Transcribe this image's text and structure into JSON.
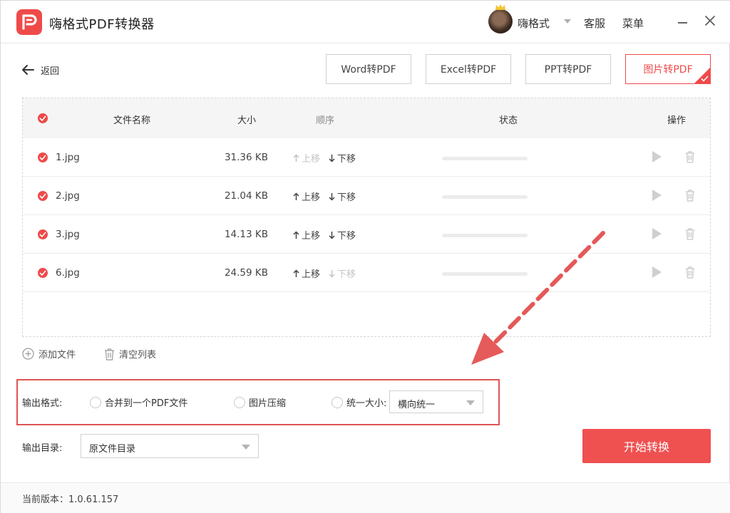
{
  "app": {
    "title": "嗨格式PDF转换器"
  },
  "header": {
    "user_name": "嗨格式",
    "service_label": "客服",
    "menu_label": "菜单"
  },
  "nav": {
    "back_label": "返回"
  },
  "tabs": [
    {
      "label": "Word转PDF",
      "active": false
    },
    {
      "label": "Excel转PDF",
      "active": false
    },
    {
      "label": "PPT转PDF",
      "active": false
    },
    {
      "label": "图片转PDF",
      "active": true
    }
  ],
  "table": {
    "headers": {
      "name": "文件名称",
      "size": "大小",
      "order": "顺序",
      "status": "状态",
      "ops": "操作"
    },
    "move_up_label": "上移",
    "move_down_label": "下移",
    "rows": [
      {
        "name": "1.jpg",
        "size": "31.36 KB",
        "up_enabled": false,
        "down_enabled": true
      },
      {
        "name": "2.jpg",
        "size": "21.04 KB",
        "up_enabled": true,
        "down_enabled": true
      },
      {
        "name": "3.jpg",
        "size": "14.13 KB",
        "up_enabled": true,
        "down_enabled": true
      },
      {
        "name": "6.jpg",
        "size": "24.59 KB",
        "up_enabled": true,
        "down_enabled": false
      }
    ]
  },
  "actions": {
    "add_file": "添加文件",
    "clear_list": "清空列表"
  },
  "output_format": {
    "label": "输出格式:",
    "options": [
      "合并到一个PDF文件",
      "图片压缩",
      "统一大小:"
    ],
    "size_select_value": "横向统一"
  },
  "output_dir": {
    "label": "输出目录:",
    "value": "原文件目录"
  },
  "start_button": "开始转换",
  "footer": {
    "version_text": "当前版本：1.0.61.157"
  },
  "colors": {
    "accent": "#ef4a4a",
    "highlight_box": "#e05454"
  },
  "icons": [
    "logo-icon",
    "crown-icon",
    "chevron-down-icon",
    "minimize-icon",
    "close-icon",
    "back-arrow-icon",
    "check-icon",
    "arrow-up-icon",
    "arrow-down-icon",
    "play-icon",
    "trash-icon",
    "add-circle-icon"
  ]
}
